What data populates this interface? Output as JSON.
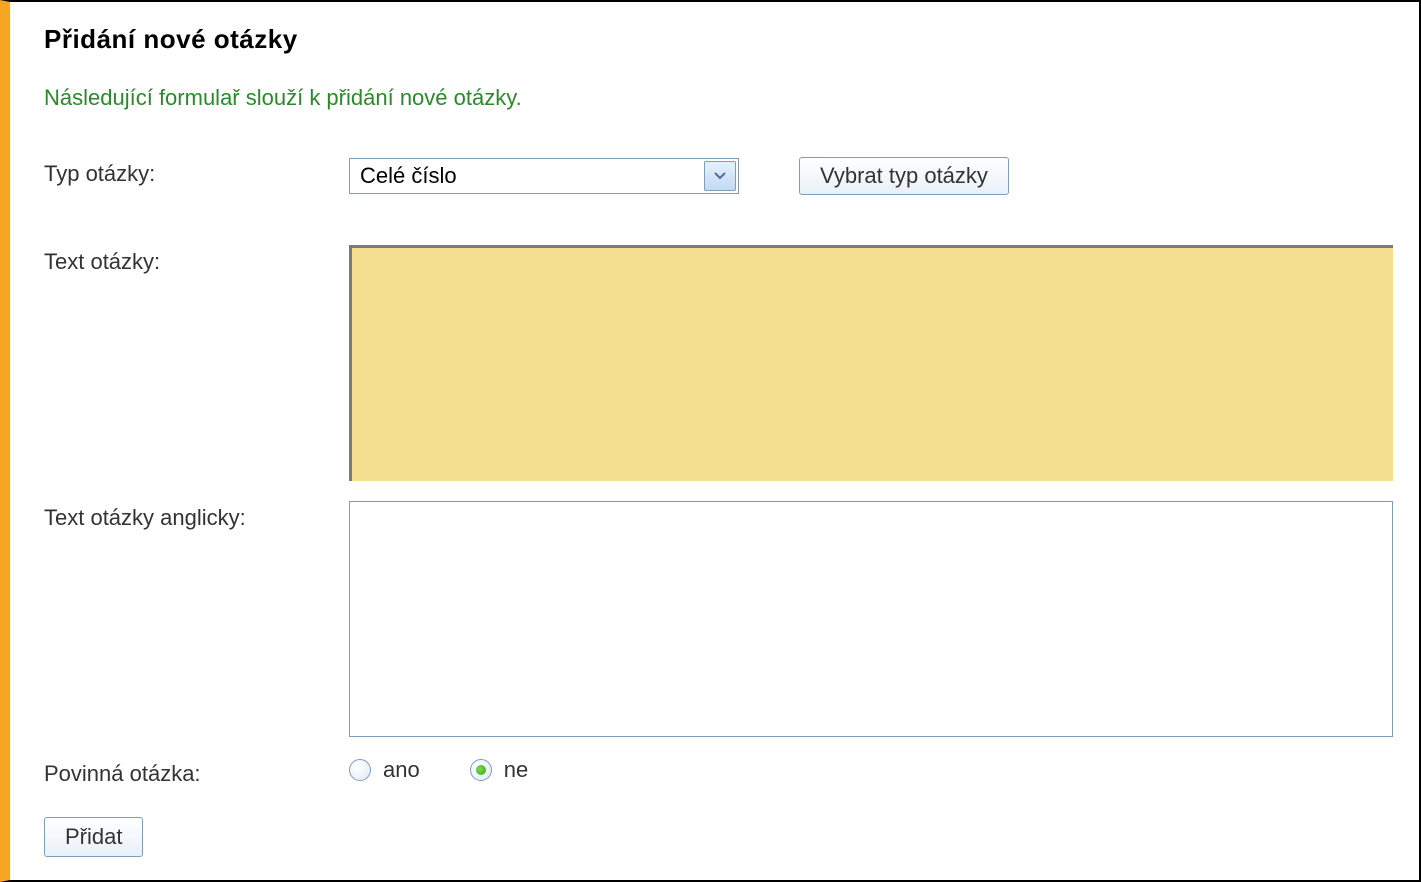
{
  "page": {
    "title": "Přidání nové otázky",
    "intro": "Následující formulař slouží k přidání nové otázky."
  },
  "form": {
    "typeLabel": "Typ otázky:",
    "typeSelected": "Celé číslo",
    "selectTypeButton": "Vybrat typ otázky",
    "textCzLabel": "Text otázky:",
    "textCzValue": "",
    "textEnLabel": "Text otázky anglicky:",
    "textEnValue": "",
    "mandatoryLabel": "Povinná otázka:",
    "mandatoryYes": "ano",
    "mandatoryNo": "ne",
    "mandatoryValue": "ne",
    "submit": "Přidat"
  }
}
